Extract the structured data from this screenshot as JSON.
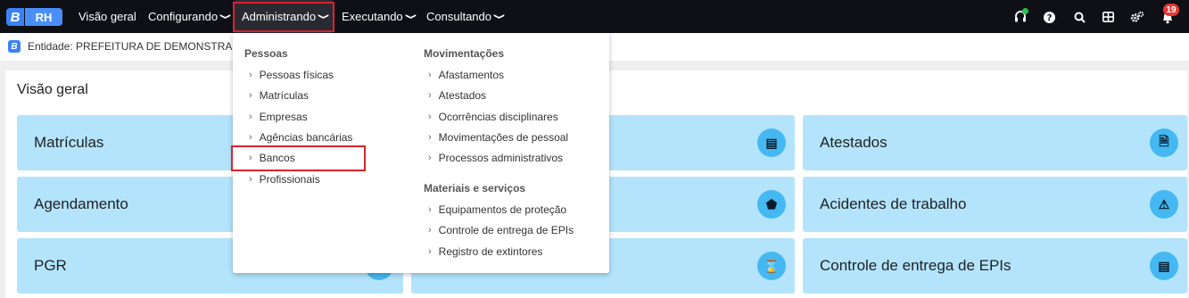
{
  "app": {
    "logo_letter": "B",
    "logo_text": "RH"
  },
  "nav": {
    "items": [
      {
        "label": "Visão geral",
        "has_chevron": false
      },
      {
        "label": "Configurando",
        "has_chevron": true
      },
      {
        "label": "Administrando",
        "has_chevron": true,
        "active": true
      },
      {
        "label": "Executando",
        "has_chevron": true
      },
      {
        "label": "Consultando",
        "has_chevron": true
      }
    ],
    "chevron": "❯",
    "icons": [
      "headset-icon",
      "help-icon",
      "search-icon",
      "grid-icon",
      "settings-icon",
      "bell-icon"
    ],
    "notification_count": "19"
  },
  "entity": {
    "icon_letter": "B",
    "text": "Entidade: PREFEITURA DE DEMONSTRAÇÃO"
  },
  "overview": {
    "title": "Visão geral",
    "cards": [
      {
        "label": "Matrículas",
        "icon": ""
      },
      {
        "label": "",
        "icon": "▤"
      },
      {
        "label": "Atestados",
        "icon": "🗎"
      },
      {
        "label": "Agendamento",
        "icon": ""
      },
      {
        "label": "",
        "icon": "⬟"
      },
      {
        "label": "Acidentes de trabalho",
        "icon": "⚠"
      },
      {
        "label": "PGR",
        "icon": ""
      },
      {
        "label": "",
        "icon": "⌛"
      },
      {
        "label": "Controle de entrega de EPIs",
        "icon": "▤"
      }
    ]
  },
  "menu": {
    "pessoas": {
      "heading": "Pessoas",
      "items": [
        "Pessoas físicas",
        "Matrículas",
        "Empresas",
        "Agências bancárias",
        "Bancos",
        "Profissionais"
      ]
    },
    "movimentacoes": {
      "heading": "Movimentações",
      "items": [
        "Afastamentos",
        "Atestados",
        "Ocorrências disciplinares",
        "Movimentações de pessoal",
        "Processos administrativos"
      ]
    },
    "materiais": {
      "heading": "Materiais e serviços",
      "items": [
        "Equipamentos de proteção",
        "Controle de entrega de EPIs",
        "Registro de extintores"
      ]
    },
    "arrow": "›",
    "highlighted_item": "Bancos"
  },
  "colors": {
    "navbar": "#0f0f16",
    "card": "#b3e4fc",
    "card_icon": "#45b8f2",
    "highlight": "#d9232e",
    "brand": "#3a82f7"
  }
}
